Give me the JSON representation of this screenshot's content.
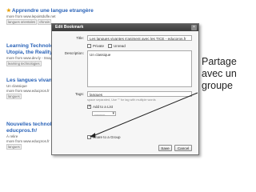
{
  "bookmarks": [
    {
      "title": "Apprendre une langue etrangère",
      "source": "more from www.lepointdufle.net",
      "tags": [
        "langues orientales",
        "chinois"
      ]
    },
    {
      "title": "Learning Technology",
      "subtitle": "Utopia, the Reality",
      "source": "more from www.dev.ly - Snapshot",
      "tags": [
        "learning technologies"
      ]
    },
    {
      "title": "Les langues vivantes",
      "description": "Un classique",
      "source": "more from www.educpros.fr",
      "tags": [
        "langues"
      ]
    },
    {
      "title": "Nouvelles technologie",
      "subtitle": "educpros.fr/",
      "description": "À relire",
      "source": "more from www.educpros.fr",
      "tags": [
        "langues"
      ]
    }
  ],
  "dialog": {
    "title": "Edit Bookmark",
    "fields": {
      "title_label": "Title:",
      "title_value": "Les langues vivantes s'animent avec les TICE - educpros.fr",
      "private_label": "Private",
      "unread_label": "Unread",
      "description_label": "Description:",
      "description_value": "Un classique",
      "tags_label": "Tags:",
      "tags_value": "langues",
      "tags_hint": "space separated, Use \"\" for tag with multiple words",
      "add_to_list_label": "Add to a List",
      "list_select_value": "----------",
      "share_group_label": "Share to a Group"
    },
    "buttons": {
      "save": "Save",
      "cancel": "Cancel"
    }
  },
  "annotation": {
    "line1": "Partage",
    "line2": "avec un",
    "line3": "groupe"
  }
}
